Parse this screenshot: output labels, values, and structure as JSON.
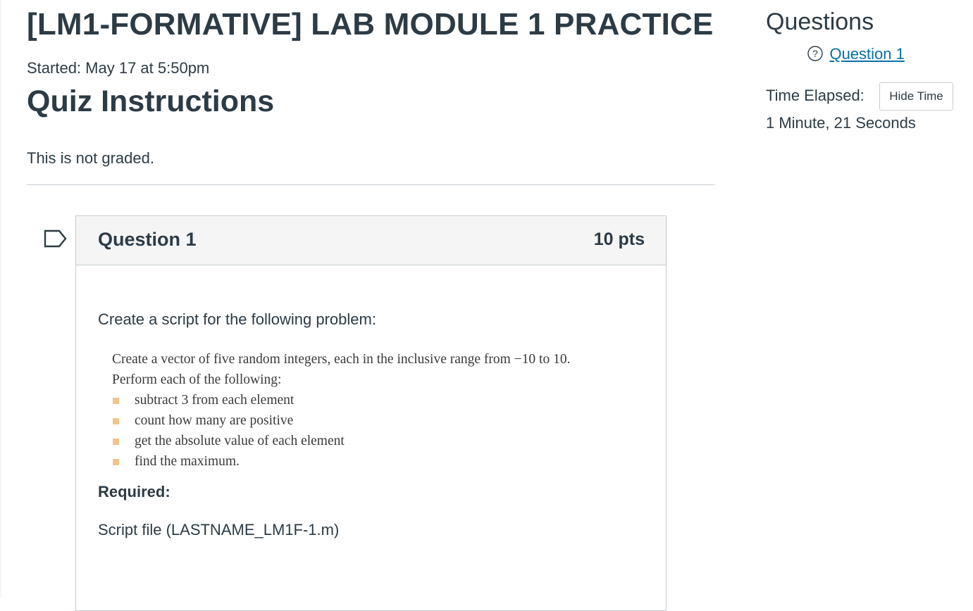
{
  "quiz": {
    "title": "[LM1-FORMATIVE] LAB MODULE 1 PRACTICE",
    "started": "Started: May 17 at 5:50pm",
    "instructions_heading": "Quiz Instructions",
    "instructions_text": "This is not graded."
  },
  "question": {
    "name": "Question 1",
    "points": "10 pts",
    "flag_icon": "flag-icon",
    "prompt": "Create a script for the following problem:",
    "problem": {
      "line1": "Create a vector of five random integers, each in the inclusive range from −10 to 10.",
      "line2": "Perform each of the following:",
      "bullets": [
        "subtract 3 from each element",
        "count how many are positive",
        "get the absolute value of each element",
        "find the maximum."
      ],
      "bullet_color": "#f2c48a"
    },
    "required_label": "Required:",
    "script_file": "Script file (LASTNAME_LM1F-1.m)"
  },
  "sidebar": {
    "heading": "Questions",
    "question_links": [
      {
        "icon": "help-circle-icon",
        "label": "Question 1"
      }
    ],
    "time_elapsed_label": "Time Elapsed:",
    "hide_time_button": "Hide Time",
    "time_elapsed_value": "1 Minute, 21 Seconds"
  },
  "colors": {
    "text": "#2d3b45",
    "link": "#0770a3",
    "border": "#c7cdd1",
    "header_bg": "#f5f5f5"
  }
}
